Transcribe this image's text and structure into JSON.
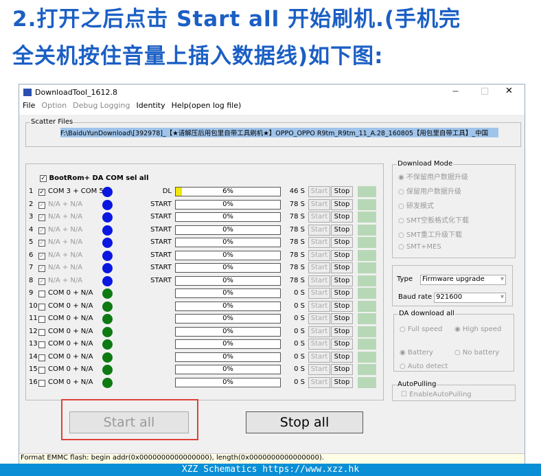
{
  "heading": {
    "line1": "2.打开之后点击 Start all  开始刷机.(手机完",
    "line2": "全关机按住音量上插入数据线)如下图:"
  },
  "window": {
    "title": "DownloadTool_1612.8",
    "min": "−",
    "max": "□",
    "close": "✕"
  },
  "menu": [
    "File",
    "Option",
    "Debug Logging",
    "Identity",
    "Help(open log file)"
  ],
  "scatter": {
    "label": "Scatter Files",
    "path": "F:\\BaiduYunDownload\\[392978]_【★请解压后用包里自带工具刷机★】OPPO_OPPO R9tm_R9tm_11_A.28_160805【用包里自带工具】_中国"
  },
  "selall": "BootRom+ DA COM sel all",
  "ports": [
    {
      "n": "1",
      "com": "COM 3 + COM 5",
      "state": "DL",
      "pct": "6%",
      "progress": 6,
      "time": "46 S",
      "color": "#0a17e0",
      "enabled": true
    },
    {
      "n": "2",
      "com": "N/A + N/A",
      "state": "START",
      "pct": "0%",
      "progress": 0,
      "time": "78 S",
      "color": "#0a17e0",
      "enabled": false
    },
    {
      "n": "3",
      "com": "N/A + N/A",
      "state": "START",
      "pct": "0%",
      "progress": 0,
      "time": "78 S",
      "color": "#0a17e0",
      "enabled": false
    },
    {
      "n": "4",
      "com": "N/A + N/A",
      "state": "START",
      "pct": "0%",
      "progress": 0,
      "time": "78 S",
      "color": "#0a17e0",
      "enabled": false
    },
    {
      "n": "5",
      "com": "N/A + N/A",
      "state": "START",
      "pct": "0%",
      "progress": 0,
      "time": "78 S",
      "color": "#0a17e0",
      "enabled": false
    },
    {
      "n": "6",
      "com": "N/A + N/A",
      "state": "START",
      "pct": "0%",
      "progress": 0,
      "time": "78 S",
      "color": "#0a17e0",
      "enabled": false
    },
    {
      "n": "7",
      "com": "N/A + N/A",
      "state": "START",
      "pct": "0%",
      "progress": 0,
      "time": "78 S",
      "color": "#0a17e0",
      "enabled": false
    },
    {
      "n": "8",
      "com": "N/A + N/A",
      "state": "START",
      "pct": "0%",
      "progress": 0,
      "time": "78 S",
      "color": "#0a17e0",
      "enabled": false
    },
    {
      "n": "9",
      "com": "COM 0 + N/A",
      "state": "",
      "pct": "0%",
      "progress": 0,
      "time": "0 S",
      "color": "#0d7a12",
      "enabled": true
    },
    {
      "n": "10",
      "com": "COM 0 + N/A",
      "state": "",
      "pct": "0%",
      "progress": 0,
      "time": "0 S",
      "color": "#0d7a12",
      "enabled": true
    },
    {
      "n": "11",
      "com": "COM 0 + N/A",
      "state": "",
      "pct": "0%",
      "progress": 0,
      "time": "0 S",
      "color": "#0d7a12",
      "enabled": true
    },
    {
      "n": "12",
      "com": "COM 0 + N/A",
      "state": "",
      "pct": "0%",
      "progress": 0,
      "time": "0 S",
      "color": "#0d7a12",
      "enabled": true
    },
    {
      "n": "13",
      "com": "COM 0 + N/A",
      "state": "",
      "pct": "0%",
      "progress": 0,
      "time": "0 S",
      "color": "#0d7a12",
      "enabled": true
    },
    {
      "n": "14",
      "com": "COM 0 + N/A",
      "state": "",
      "pct": "0%",
      "progress": 0,
      "time": "0 S",
      "color": "#0d7a12",
      "enabled": true
    },
    {
      "n": "15",
      "com": "COM 0 + N/A",
      "state": "",
      "pct": "0%",
      "progress": 0,
      "time": "0 S",
      "color": "#0d7a12",
      "enabled": true
    },
    {
      "n": "16",
      "com": "COM 0 + N/A",
      "state": "",
      "pct": "0%",
      "progress": 0,
      "time": "0 S",
      "color": "#0d7a12",
      "enabled": true
    }
  ],
  "start_label": "Start",
  "stop_label": "Stop",
  "download_mode": {
    "label": "Download Mode",
    "options": [
      "不保留用户数据升级",
      "保留用户数据升级",
      "研发模式",
      "SMT空板格式化下载",
      "SMT重工升级下载",
      "SMT+MES"
    ]
  },
  "type": {
    "label": "Type",
    "value": "Firmware upgrade"
  },
  "baud": {
    "label": "Baud rate",
    "value": "921600"
  },
  "da": {
    "label": "DA download all",
    "full": "Full speed",
    "high": "High speed",
    "battery": "Battery",
    "nobattery": "No battery",
    "auto": "Auto detect"
  },
  "autopulling": {
    "label": "AutoPulling",
    "check": "EnableAutoPulling"
  },
  "start_all": "Start all",
  "stop_all": "Stop all",
  "status": "Format EMMC flash:  begin addr(0x0000000000000000), length(0x0000000000000000).",
  "footer": "XZZ Schematics https://www.xzz.hk"
}
